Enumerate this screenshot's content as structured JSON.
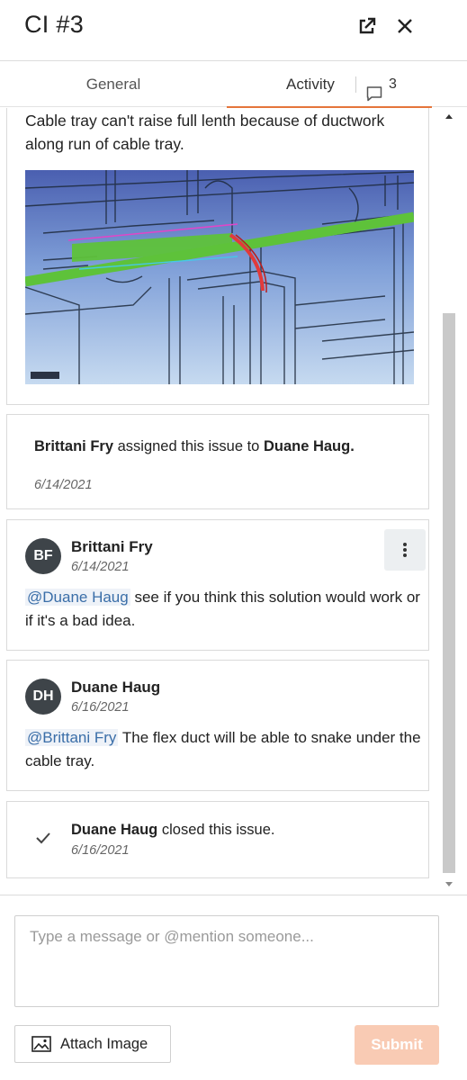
{
  "header": {
    "title": "CI #3",
    "popout_icon": "external-link-icon",
    "close_icon": "close-icon"
  },
  "tabs": {
    "general": "General",
    "activity": "Activity",
    "comment_count": "3",
    "active_color": "#e5753b"
  },
  "feed": {
    "issue": {
      "description": "Cable tray can't raise full lenth because of ductwork along run of cable tray."
    },
    "assignment": {
      "actor": "Brittani Fry",
      "action": " assigned this issue to ",
      "assignee": "Duane Haug.",
      "date": "6/14/2021"
    },
    "comments": [
      {
        "initials": "BF",
        "author": "Brittani Fry",
        "date": "6/14/2021",
        "mention": "@Duane Haug",
        "text": " see if you think this solution would work or if it's a bad idea."
      },
      {
        "initials": "DH",
        "author": "Duane Haug",
        "date": "6/16/2021",
        "mention": "@Brittani Fry",
        "text": "  The flex duct will be able to snake under the cable tray."
      }
    ],
    "closed": {
      "actor": "Duane Haug",
      "action": " closed this issue.",
      "date": "6/16/2021"
    }
  },
  "composer": {
    "placeholder": "Type a message or @mention someone...",
    "attach_label": "Attach Image",
    "submit_label": "Submit",
    "submit_color": "#f9cbb4"
  }
}
